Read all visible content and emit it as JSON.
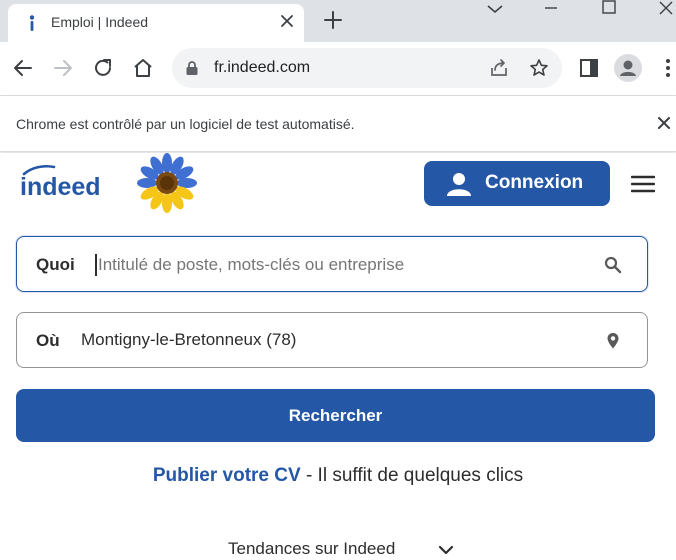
{
  "browser": {
    "tab": {
      "title": "Emploi | Indeed",
      "favicon": "indeed-i-icon"
    },
    "url": "fr.indeed.com",
    "infobar": "Chrome est contrôlé par un logiciel de test automatisé."
  },
  "header": {
    "logo_text": "indeed",
    "login_label": "Connexion"
  },
  "search": {
    "what_label": "Quoi",
    "what_placeholder": "Intitulé de poste, mots-clés ou entreprise",
    "what_value": "",
    "where_label": "Où",
    "where_value": "Montigny-le-Bretonneux (78)",
    "button_label": "Rechercher"
  },
  "cv": {
    "link": "Publier votre CV",
    "text": " - Il suffit de quelques clics"
  },
  "trends": {
    "label": "Tendances sur Indeed"
  },
  "colors": {
    "brand": "#2557a7",
    "tabstrip": "#dee1e6",
    "omnibox": "#f1f3f4"
  }
}
